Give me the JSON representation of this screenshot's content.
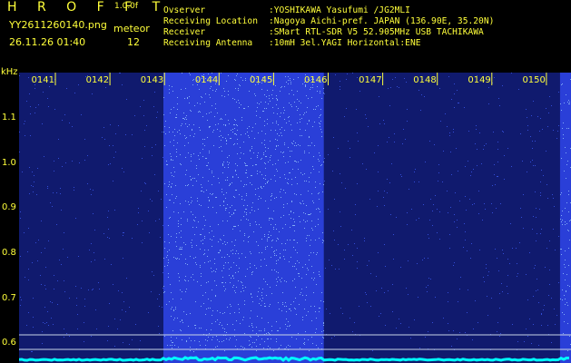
{
  "header": {
    "title": "H R O F F T",
    "version": "1.0.0f",
    "filename": "YY2611260140.png",
    "kind": "meteor",
    "datetime": "26.11.26 01:40",
    "count": "12"
  },
  "info": [
    {
      "label": "Ovserver",
      "value": ":YOSHIKAWA Yasufumi /JG2MLI"
    },
    {
      "label": "Receiving Location",
      "value": ":Nagoya Aichi-pref. JAPAN (136.90E, 35.20N)"
    },
    {
      "label": "Receiver",
      "value": ":SMart RTL-SDR V5 52.905MHz USB TACHIKAWA"
    },
    {
      "label": "Receiving Antenna",
      "value": ":10mH 3el.YAGI Horizontal:ENE"
    }
  ],
  "spectrogram": {
    "y_unit": "kHz",
    "y_ticks": [
      "1.1",
      "1.0",
      "0.9",
      "0.8",
      "0.7",
      "0.6"
    ],
    "x_ticks": [
      "0141",
      "0142",
      "0143",
      "0144",
      "0145",
      "0146",
      "0147",
      "0148",
      "0149",
      "0150"
    ],
    "colors": {
      "background": "#000000",
      "low_noise": "#101a6e",
      "high_noise": "#2a3fd8",
      "speckle": "#9fd0ff",
      "tick": "#ffff3a",
      "baseline": "#00ffff",
      "refline": "#c9d4e6"
    },
    "bright_bands_minutes": [
      [
        1.98,
        4.92
      ],
      [
        9.25,
        10.0
      ]
    ]
  }
}
